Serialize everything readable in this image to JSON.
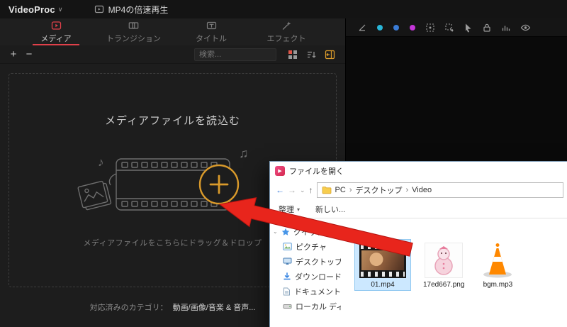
{
  "app": {
    "logo": "VideoProc",
    "logo_caret": "∨",
    "project_title": "MP4の倍速再生",
    "tabs": [
      {
        "label": "メディア"
      },
      {
        "label": "トランジション"
      },
      {
        "label": "タイトル"
      },
      {
        "label": "エフェクト"
      }
    ],
    "toolbar": {
      "add_label": "+",
      "remove_label": "−",
      "search_placeholder": "検索..."
    }
  },
  "media_panel": {
    "headline": "メディアファイルを読込む",
    "drop_hint": "メディアファイルをこちらにドラッグ＆ドロップ",
    "category_label": "対応済みのカテゴリ：",
    "category_value": "動画/画像/音楽 & 音声..."
  },
  "dialog": {
    "title": "ファイルを開く",
    "nav": {
      "back": "←",
      "forward": "→",
      "caret": "⌄",
      "up": "↑"
    },
    "breadcrumb": {
      "sep": "›",
      "items": [
        "PC",
        "デスクトップ",
        "Video"
      ]
    },
    "toolbar": {
      "organize": "整理",
      "organize_caret": "▾",
      "new_item": "新しい..."
    },
    "sidebar": {
      "expander": "⌄",
      "items": [
        {
          "label": "クイック アクセス"
        },
        {
          "label": "ピクチャ"
        },
        {
          "label": "デスクトップ"
        },
        {
          "label": "ダウンロード"
        },
        {
          "label": "ドキュメント"
        },
        {
          "label": "ローカル ディスク..."
        }
      ]
    },
    "files": [
      {
        "name": "01.mp4"
      },
      {
        "name": "17ed667.png"
      },
      {
        "name": "bgm.mp3"
      }
    ]
  },
  "colors": {
    "accent_red": "#e0404a",
    "accent_yellow": "#d99a2b",
    "arrow_red": "#e8251c",
    "selection_blue": "#cce8ff"
  }
}
